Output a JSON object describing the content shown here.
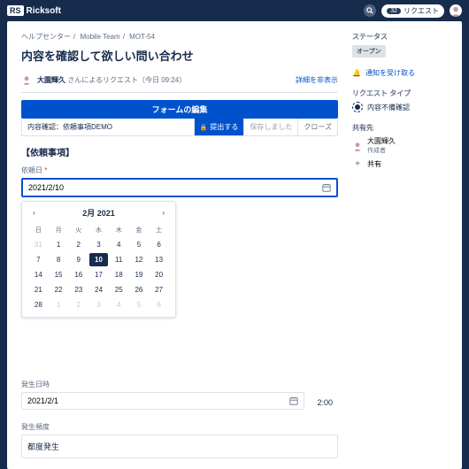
{
  "topbar": {
    "logo_prefix": "RS",
    "logo_text": "Ricksoft",
    "badge_count": "32",
    "request_label": "リクエスト"
  },
  "breadcrumb": {
    "a": "ヘルプセンター",
    "b": "Mobile Team",
    "c": "MOT-54"
  },
  "title": "内容を確認して欲しい問い合わせ",
  "request_line": {
    "name": "大園輝久",
    "suffix": "さんによるリクエスト（今日 09:24）",
    "hide": "詳細を非表示"
  },
  "form": {
    "edit_bar": "フォームの編集",
    "action_title": "内容確認：依頼事項DEMO",
    "submit": "提出する",
    "saved": "保存しました",
    "close": "クローズ"
  },
  "section_title": "【依頼事項】",
  "date_field": {
    "label": "依頼日",
    "value": "2021/2/10"
  },
  "calendar": {
    "month": "2月 2021",
    "dow": [
      "日",
      "月",
      "火",
      "水",
      "木",
      "金",
      "土"
    ],
    "rows": [
      [
        "31",
        "1",
        "2",
        "3",
        "4",
        "5",
        "6"
      ],
      [
        "7",
        "8",
        "9",
        "10",
        "11",
        "12",
        "13"
      ],
      [
        "14",
        "15",
        "16",
        "17",
        "18",
        "19",
        "20"
      ],
      [
        "21",
        "22",
        "23",
        "24",
        "25",
        "26",
        "27"
      ],
      [
        "28",
        "1",
        "2",
        "3",
        "4",
        "5",
        "6"
      ]
    ],
    "selected": "10",
    "muted_first": [
      "31"
    ],
    "muted_last_row": 4
  },
  "datetime_field": {
    "label": "発生日時",
    "date": "2021/2/1",
    "time": "2:00"
  },
  "freq_field": {
    "label": "発生頻度",
    "value": "都度発生"
  },
  "side": {
    "status_label": "ステータス",
    "status_value": "オープン",
    "notify": "通知を受け取る",
    "type_label": "リクエスト タイプ",
    "type_value": "内容不備確認",
    "share_label": "共有先",
    "share_user": "大園輝久",
    "share_role": "作成者",
    "share_add": "共有"
  }
}
